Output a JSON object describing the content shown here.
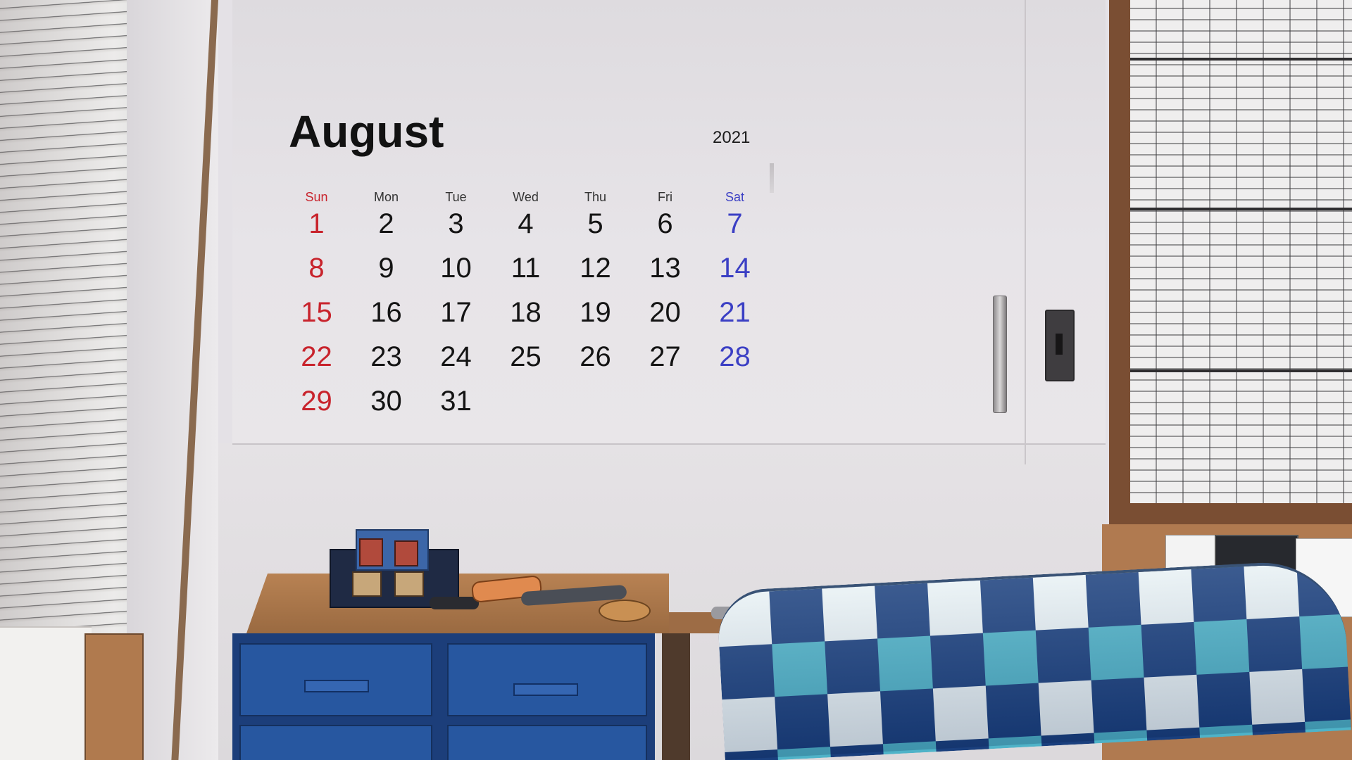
{
  "calendar": {
    "month": "August",
    "year": "2021",
    "weekdays": [
      "Sun",
      "Mon",
      "Tue",
      "Wed",
      "Thu",
      "Fri",
      "Sat"
    ],
    "weeks": [
      [
        "1",
        "2",
        "3",
        "4",
        "5",
        "6",
        "7"
      ],
      [
        "8",
        "9",
        "10",
        "11",
        "12",
        "13",
        "14"
      ],
      [
        "15",
        "16",
        "17",
        "18",
        "19",
        "20",
        "21"
      ],
      [
        "22",
        "23",
        "24",
        "25",
        "26",
        "27",
        "28"
      ],
      [
        "29",
        "30",
        "31",
        "",
        "",
        "",
        ""
      ]
    ],
    "colors": {
      "sunday": "#c8232c",
      "saturday": "#3b3fc4",
      "weekday": "#141414"
    }
  },
  "scene": {
    "icons": [
      "window-blinds-icon",
      "door-handle-icon",
      "light-switch-icon",
      "desk-icon",
      "drawer-icon",
      "bed-blanket-icon"
    ],
    "colors": {
      "wall": "#e4e1e6",
      "wood": "#b07a50",
      "drawer_blue": "#2757a0",
      "blanket_navy": "#1a3f7d",
      "blanket_teal": "#4fb3c8"
    }
  }
}
